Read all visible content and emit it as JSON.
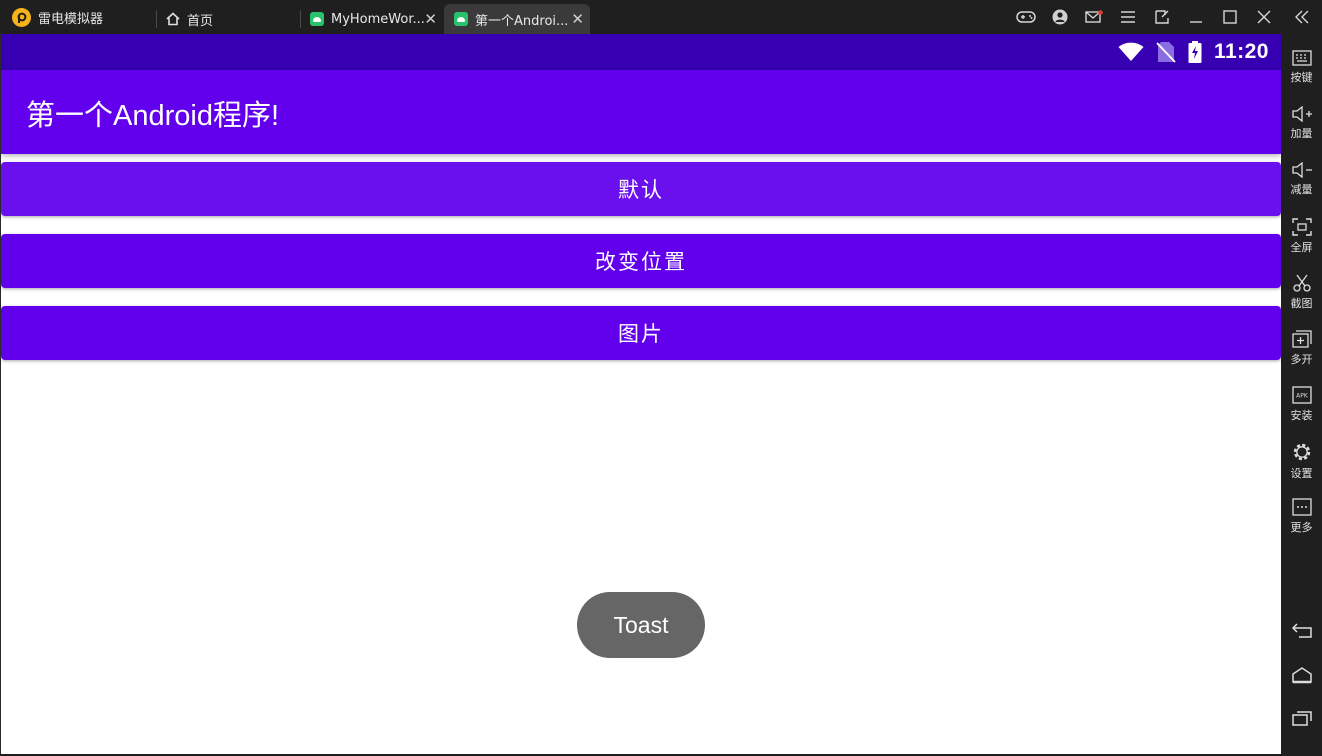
{
  "emulator": {
    "brand": "雷电模拟器",
    "tabs": [
      {
        "label": "首页"
      },
      {
        "label": "MyHomeWor..."
      },
      {
        "label": "第一个Androi..."
      }
    ]
  },
  "status_bar": {
    "time": "11:20"
  },
  "app": {
    "title": "第一个Android程序!",
    "buttons": {
      "default": "默认",
      "change_position": "改变位置",
      "image": "图片"
    },
    "toast": "Toast"
  },
  "sidebar": {
    "keys": "按键",
    "vol_up": "加量",
    "vol_down": "减量",
    "fullscreen": "全屏",
    "screenshot": "截图",
    "multi": "多开",
    "install": "安装",
    "settings": "设置",
    "more": "更多"
  },
  "colors": {
    "primary": "#6200ee",
    "primary_dark": "#3700b3",
    "toast_bg": "#666666",
    "chrome_bg": "#1f1f1f"
  }
}
